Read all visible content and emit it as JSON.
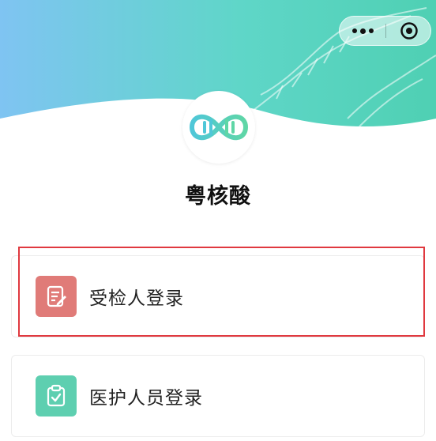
{
  "app": {
    "name": "粤核酸"
  },
  "capsule": {
    "more_icon": "more-dots-icon",
    "close_icon": "target-circle-icon"
  },
  "login_options": [
    {
      "label": "受检人登录",
      "icon": "edit-document-icon",
      "color": "#e07b78",
      "highlighted": true
    },
    {
      "label": "医护人员登录",
      "icon": "clipboard-check-icon",
      "color": "#5ecfb0",
      "highlighted": false
    }
  ],
  "colors": {
    "highlight_border": "#e0393f",
    "header_gradient": [
      "#7fc4f2",
      "#4fd0b3"
    ]
  }
}
